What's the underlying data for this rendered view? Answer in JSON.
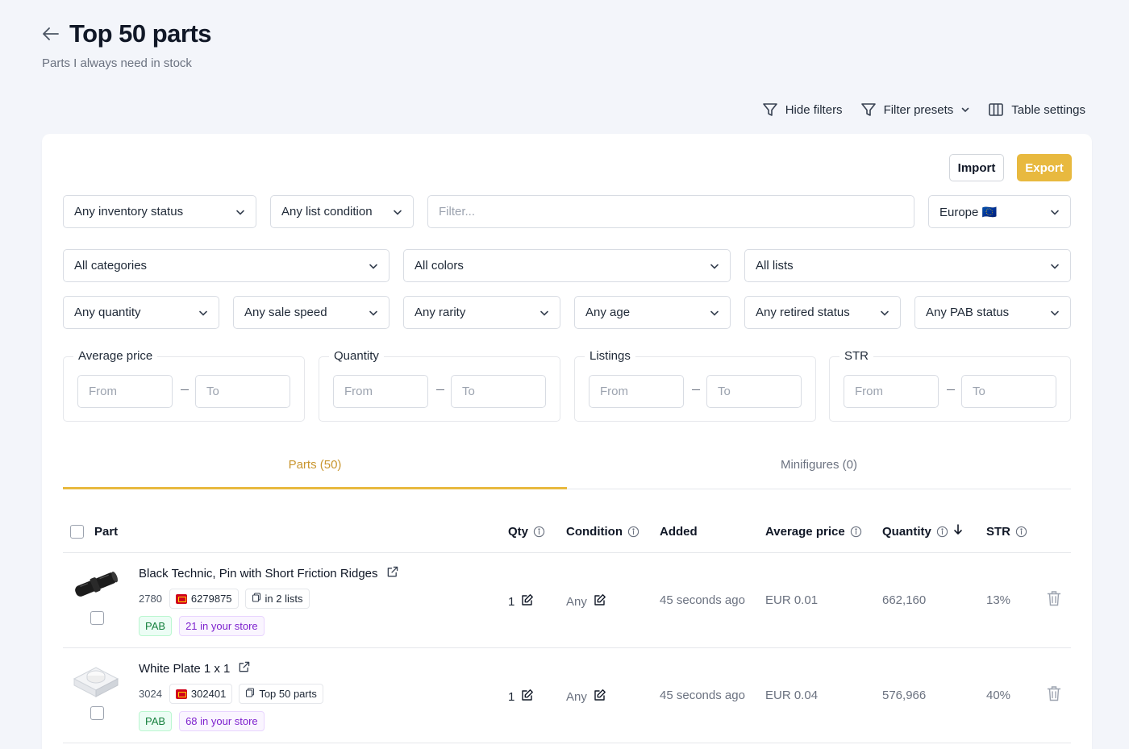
{
  "header": {
    "title": "Top 50 parts",
    "subtitle": "Parts I always need in stock"
  },
  "toolbar": {
    "hide_filters": "Hide filters",
    "filter_presets": "Filter presets",
    "table_settings": "Table settings"
  },
  "actions": {
    "import": "Import",
    "export": "Export"
  },
  "filters": {
    "inventory_status": "Any inventory status",
    "list_condition": "Any list condition",
    "search_placeholder": "Filter...",
    "region": "Europe 🇪🇺",
    "categories": "All categories",
    "colors": "All colors",
    "lists": "All lists",
    "quantity": "Any quantity",
    "sale_speed": "Any sale speed",
    "rarity": "Any rarity",
    "age": "Any age",
    "retired_status": "Any retired status",
    "pab_status": "Any PAB status"
  },
  "ranges": [
    {
      "label": "Average price",
      "from": "From",
      "to": "To"
    },
    {
      "label": "Quantity",
      "from": "From",
      "to": "To"
    },
    {
      "label": "Listings",
      "from": "From",
      "to": "To"
    },
    {
      "label": "STR",
      "from": "From",
      "to": "To"
    }
  ],
  "tabs": {
    "parts": "Parts (50)",
    "minifigures": "Minifigures (0)"
  },
  "columns": {
    "part": "Part",
    "qty": "Qty",
    "condition": "Condition",
    "added": "Added",
    "average_price": "Average price",
    "quantity": "Quantity",
    "str": "STR"
  },
  "rows": [
    {
      "name": "Black Technic, Pin with Short Friction Ridges",
      "part_no": "2780",
      "lego_id": "6279875",
      "lists": "in 2 lists",
      "pab": "PAB",
      "store": "21 in your store",
      "qty": "1",
      "condition": "Any",
      "added": "45 seconds ago",
      "avg_price": "EUR 0.01",
      "quantity": "662,160",
      "str": "13%"
    },
    {
      "name": "White Plate 1 x 1",
      "part_no": "3024",
      "lego_id": "302401",
      "lists": "Top 50 parts",
      "pab": "PAB",
      "store": "68 in your store",
      "qty": "1",
      "condition": "Any",
      "added": "45 seconds ago",
      "avg_price": "EUR 0.04",
      "quantity": "576,966",
      "str": "40%"
    }
  ]
}
